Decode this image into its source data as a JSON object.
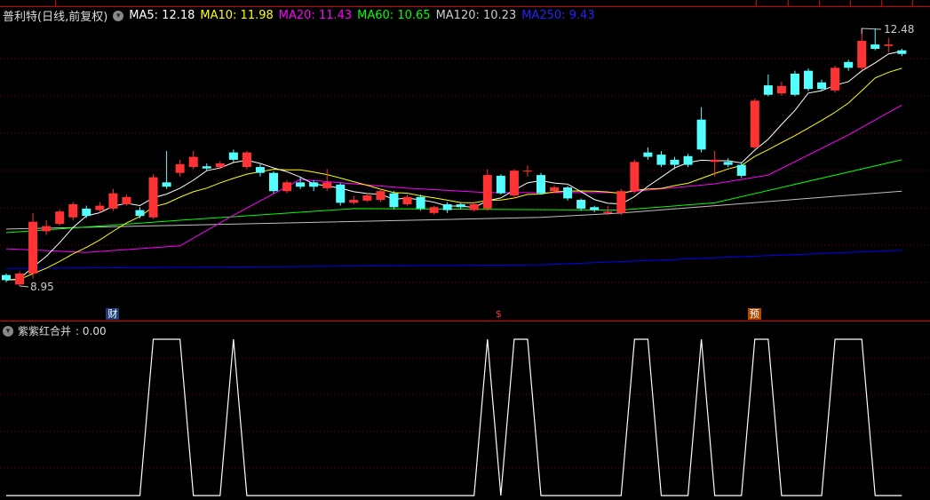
{
  "header": {
    "title": "普利特(日线,前复权)",
    "ma5": "MA5: 12.18",
    "ma10": "MA10: 11.98",
    "ma20": "MA20: 11.43",
    "ma60": "MA60: 10.65",
    "ma120": "MA120: 10.23",
    "ma250": "MA250: 9.43"
  },
  "colors": {
    "up": "#ff3333",
    "down": "#54ffff",
    "ma5": "#ffffff",
    "ma10": "#ffff00",
    "ma20": "#ff00ff",
    "ma60": "#00ff00",
    "ma120": "#c0c0c0",
    "ma250": "#0000ff"
  },
  "labels": {
    "high": "12.48",
    "low": "8.95"
  },
  "markers": [
    {
      "text": "财",
      "index": 8,
      "bg": "#1c3f7a",
      "color": "#fff"
    },
    {
      "text": "$",
      "index": 37,
      "bg": "transparent",
      "color": "#ff3333"
    },
    {
      "text": "预",
      "index": 56,
      "bg": "#b04a00",
      "color": "#fff"
    }
  ],
  "indicator": {
    "title": "紫紫红合并",
    "value": ": 0.00"
  },
  "chart_data": [
    {
      "type": "candlestick",
      "title": "普利特(日线,前复权)",
      "ylim": [
        8.6,
        12.8
      ],
      "candles_ochl_note": "[open, close, high, low]",
      "candles": [
        [
          9.1,
          9.03,
          9.12,
          9.0
        ],
        [
          8.97,
          9.12,
          9.15,
          8.95
        ],
        [
          9.12,
          9.83,
          9.95,
          9.05
        ],
        [
          9.7,
          9.77,
          9.85,
          9.65
        ],
        [
          9.8,
          9.97,
          10.0,
          9.78
        ],
        [
          9.89,
          10.07,
          10.1,
          9.85
        ],
        [
          10.01,
          9.91,
          10.05,
          9.88
        ],
        [
          9.99,
          10.05,
          10.1,
          9.95
        ],
        [
          10.01,
          10.22,
          10.28,
          9.98
        ],
        [
          10.07,
          10.17,
          10.2,
          10.05
        ],
        [
          9.99,
          9.91,
          10.03,
          9.88
        ],
        [
          9.89,
          10.44,
          10.48,
          9.87
        ],
        [
          10.37,
          10.31,
          10.8,
          10.28
        ],
        [
          10.5,
          10.62,
          10.68,
          10.45
        ],
        [
          10.58,
          10.72,
          10.8,
          10.55
        ],
        [
          10.59,
          10.56,
          10.63,
          10.53
        ],
        [
          10.58,
          10.63,
          10.66,
          10.55
        ],
        [
          10.78,
          10.68,
          10.82,
          10.65
        ],
        [
          10.58,
          10.78,
          10.8,
          10.55
        ],
        [
          10.58,
          10.5,
          10.62,
          10.45
        ],
        [
          10.5,
          10.25,
          10.52,
          10.22
        ],
        [
          10.25,
          10.37,
          10.4,
          10.22
        ],
        [
          10.37,
          10.31,
          10.45,
          10.28
        ],
        [
          10.37,
          10.31,
          10.4,
          10.25
        ],
        [
          10.29,
          10.37,
          10.55,
          10.25
        ],
        [
          10.34,
          10.09,
          10.36,
          10.05
        ],
        [
          10.09,
          10.13,
          10.18,
          10.07
        ],
        [
          10.12,
          10.19,
          10.22,
          10.1
        ],
        [
          10.13,
          10.25,
          10.28,
          10.1
        ],
        [
          10.22,
          10.03,
          10.25,
          10.0
        ],
        [
          10.07,
          10.17,
          10.2,
          10.05
        ],
        [
          10.17,
          10.01,
          10.2,
          9.98
        ],
        [
          9.95,
          10.03,
          10.05,
          9.93
        ],
        [
          10.07,
          9.99,
          10.1,
          9.95
        ],
        [
          10.07,
          10.03,
          10.09,
          10.0
        ],
        [
          9.99,
          10.07,
          10.1,
          9.97
        ],
        [
          10.01,
          10.47,
          10.55,
          9.98
        ],
        [
          10.46,
          10.22,
          10.48,
          10.2
        ],
        [
          10.19,
          10.53,
          10.55,
          10.15
        ],
        [
          10.52,
          10.53,
          10.6,
          10.45
        ],
        [
          10.47,
          10.22,
          10.5,
          10.2
        ],
        [
          10.25,
          10.3,
          10.33,
          10.22
        ],
        [
          10.3,
          10.15,
          10.32,
          10.12
        ],
        [
          10.13,
          10.01,
          10.15,
          9.98
        ],
        [
          10.03,
          9.99,
          10.05,
          9.96
        ],
        [
          9.95,
          9.97,
          10.05,
          9.92
        ],
        [
          9.95,
          10.25,
          10.28,
          9.92
        ],
        [
          10.25,
          10.65,
          10.68,
          10.22
        ],
        [
          10.78,
          10.72,
          10.85,
          10.68
        ],
        [
          10.75,
          10.61,
          10.8,
          10.58
        ],
        [
          10.68,
          10.61,
          10.72,
          10.55
        ],
        [
          10.73,
          10.61,
          10.76,
          10.58
        ],
        [
          11.23,
          10.82,
          11.4,
          10.78
        ],
        [
          10.65,
          10.68,
          10.8,
          10.45
        ],
        [
          10.65,
          10.61,
          10.7,
          10.58
        ],
        [
          10.61,
          10.46,
          10.65,
          10.43
        ],
        [
          10.85,
          11.49,
          11.52,
          10.83
        ],
        [
          11.7,
          11.57,
          11.85,
          11.55
        ],
        [
          11.59,
          11.69,
          11.75,
          11.56
        ],
        [
          11.86,
          11.57,
          11.9,
          11.55
        ],
        [
          11.9,
          11.65,
          11.93,
          11.62
        ],
        [
          11.74,
          11.65,
          11.78,
          11.62
        ],
        [
          11.63,
          11.94,
          11.97,
          11.6
        ],
        [
          12.02,
          11.94,
          12.05,
          11.9
        ],
        [
          11.94,
          12.31,
          12.48,
          11.9
        ],
        [
          12.26,
          12.2,
          12.48,
          12.18
        ],
        [
          12.24,
          12.26,
          12.35,
          12.15
        ],
        [
          12.18,
          12.13,
          12.2,
          12.1
        ]
      ],
      "ma_sampled": {
        "ma20": [
          [
            0,
            9.46
          ],
          [
            6,
            9.41
          ],
          [
            13,
            9.5
          ],
          [
            17,
            9.92
          ],
          [
            22,
            10.41
          ],
          [
            30,
            10.29
          ],
          [
            36,
            10.23
          ],
          [
            46,
            10.23
          ],
          [
            53,
            10.35
          ],
          [
            57,
            10.47
          ],
          [
            63,
            11.02
          ],
          [
            67,
            11.43
          ]
        ],
        "ma60": [
          [
            0,
            9.68
          ],
          [
            13,
            9.85
          ],
          [
            26,
            10.01
          ],
          [
            46,
            9.99
          ],
          [
            53,
            10.09
          ],
          [
            67,
            10.68
          ]
        ],
        "ma120": [
          [
            0,
            9.73
          ],
          [
            40,
            9.89
          ],
          [
            46,
            9.95
          ],
          [
            67,
            10.25
          ]
        ],
        "ma250": [
          [
            0,
            9.19
          ],
          [
            40,
            9.24
          ],
          [
            67,
            9.44
          ]
        ]
      }
    },
    {
      "type": "line",
      "title": "紫紫红合并",
      "ylim": [
        0,
        1
      ],
      "values": [
        0,
        0,
        0,
        0,
        0,
        0,
        0,
        0,
        0,
        0,
        0,
        1,
        1,
        1,
        0,
        0,
        0,
        1,
        0,
        0,
        0,
        0,
        0,
        0,
        0,
        0,
        0,
        0,
        0,
        0,
        0,
        0,
        0,
        0,
        0,
        0,
        1,
        0,
        1,
        1,
        0,
        0,
        0,
        0,
        0,
        0,
        0,
        1,
        1,
        0,
        0,
        0,
        1,
        0,
        0,
        0,
        1,
        1,
        0,
        0,
        0,
        0,
        1,
        1,
        1,
        0,
        0,
        0
      ]
    }
  ]
}
